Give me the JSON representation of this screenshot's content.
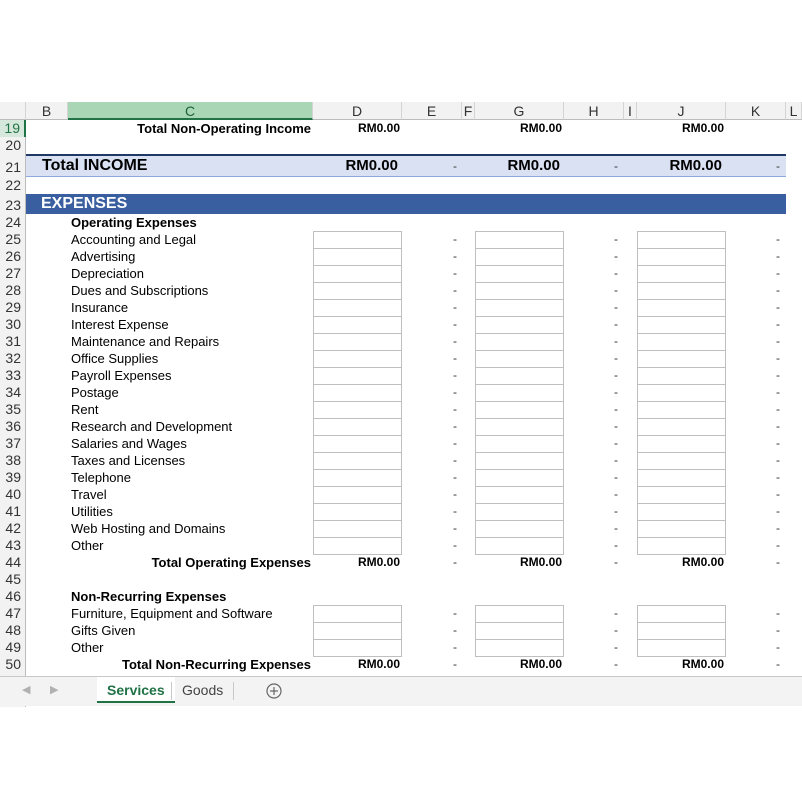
{
  "columns": [
    "B",
    "C",
    "D",
    "E",
    "F",
    "G",
    "H",
    "I",
    "J",
    "K",
    "L"
  ],
  "selected_column": "C",
  "rows": {
    "r19": {
      "num": "19",
      "label": "Total Non-Operating Income",
      "d": "RM0.00",
      "g": "RM0.00",
      "j": "RM0.00"
    },
    "r20": {
      "num": "20"
    },
    "r21": {
      "num": "21",
      "label": "Total INCOME",
      "d": "RM0.00",
      "e": "-",
      "g": "RM0.00",
      "h": "-",
      "j": "RM0.00",
      "k": "-"
    },
    "r22": {
      "num": "22"
    },
    "r23": {
      "num": "23",
      "label": "EXPENSES"
    },
    "r24": {
      "num": "24",
      "label": "Operating Expenses"
    },
    "r44": {
      "num": "44",
      "label": "Total Operating Expenses",
      "d": "RM0.00",
      "g": "RM0.00",
      "j": "RM0.00"
    },
    "r45": {
      "num": "45"
    },
    "r46": {
      "num": "46",
      "label": "Non-Recurring Expenses"
    },
    "r50": {
      "num": "50",
      "label": "Total Non-Recurring Expenses",
      "d": "RM0.00",
      "g": "RM0.00",
      "j": "RM0.00"
    }
  },
  "operating_expenses": [
    {
      "num": "25",
      "label": "Accounting and Legal"
    },
    {
      "num": "26",
      "label": "Advertising"
    },
    {
      "num": "27",
      "label": "Depreciation"
    },
    {
      "num": "28",
      "label": "Dues and Subscriptions"
    },
    {
      "num": "29",
      "label": "Insurance"
    },
    {
      "num": "30",
      "label": "Interest Expense"
    },
    {
      "num": "31",
      "label": "Maintenance and Repairs"
    },
    {
      "num": "32",
      "label": "Office Supplies"
    },
    {
      "num": "33",
      "label": "Payroll Expenses"
    },
    {
      "num": "34",
      "label": "Postage"
    },
    {
      "num": "35",
      "label": "Rent"
    },
    {
      "num": "36",
      "label": "Research and Development"
    },
    {
      "num": "37",
      "label": "Salaries and Wages"
    },
    {
      "num": "38",
      "label": "Taxes and Licenses"
    },
    {
      "num": "39",
      "label": "Telephone"
    },
    {
      "num": "40",
      "label": "Travel"
    },
    {
      "num": "41",
      "label": "Utilities"
    },
    {
      "num": "42",
      "label": "Web Hosting and Domains"
    },
    {
      "num": "43",
      "label": "Other"
    }
  ],
  "nonrecurring_expenses": [
    {
      "num": "47",
      "label": "Furniture, Equipment and Software"
    },
    {
      "num": "48",
      "label": "Gifts Given"
    },
    {
      "num": "49",
      "label": "Other"
    }
  ],
  "dash": "-",
  "tabs": {
    "services": "Services",
    "goods": "Goods",
    "add_icon": "plus-circle-icon"
  },
  "colors": {
    "accent": "#217346",
    "band_dark": "#3a5fa0",
    "band_light": "#d9e1f2"
  }
}
